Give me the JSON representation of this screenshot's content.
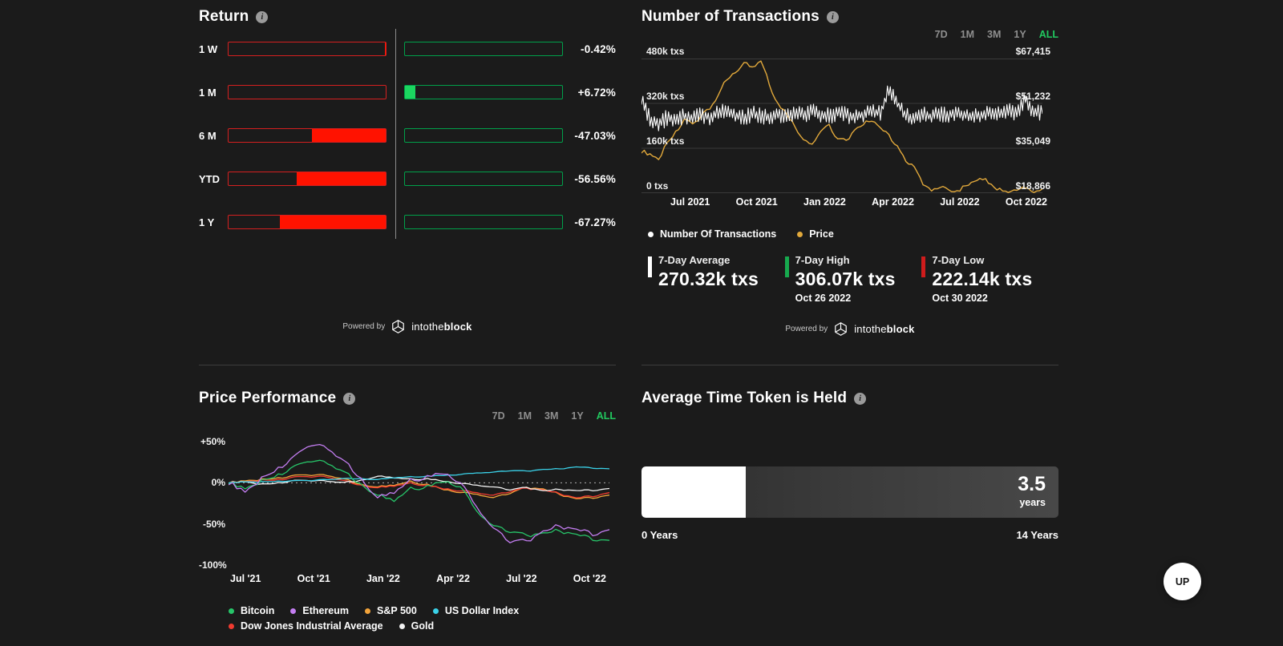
{
  "icons": {
    "info": "i"
  },
  "branding": {
    "powered_by": "Powered by",
    "brand_light": "intothe",
    "brand_bold": "block"
  },
  "up_button": {
    "label": "UP"
  },
  "return_panel": {
    "title": "Return",
    "rows": [
      {
        "label": "1 W",
        "value": "-0.42%",
        "pct": -0.42
      },
      {
        "label": "1 M",
        "value": "+6.72%",
        "pct": 6.72
      },
      {
        "label": "6 M",
        "value": "-47.03%",
        "pct": -47.03
      },
      {
        "label": "YTD",
        "value": "-56.56%",
        "pct": -56.56
      },
      {
        "label": "1 Y",
        "value": "-67.27%",
        "pct": -67.27
      }
    ],
    "colors": {
      "negative": "#ff1200",
      "negative_border": "#d42020",
      "positive": "#1bd760",
      "positive_border": "#00a04a"
    }
  },
  "transactions_panel": {
    "title": "Number of Transactions",
    "ranges": [
      "7D",
      "1M",
      "3M",
      "1Y",
      "ALL"
    ],
    "active_range": "ALL",
    "legend": [
      {
        "label": "Number Of Transactions",
        "color": "#ffffff"
      },
      {
        "label": "Price",
        "color": "#e2a93b"
      }
    ],
    "stats": [
      {
        "label": "7-Day Average",
        "value": "270.32k txs",
        "date": "",
        "color": "#ffffff"
      },
      {
        "label": "7-Day High",
        "value": "306.07k txs",
        "date": "Oct 26 2022",
        "color": "#17a94e"
      },
      {
        "label": "7-Day Low",
        "value": "222.14k txs",
        "date": "Oct 30 2022",
        "color": "#cf1c1c"
      }
    ]
  },
  "performance_panel": {
    "title": "Price Performance",
    "ranges": [
      "7D",
      "1M",
      "3M",
      "1Y",
      "ALL"
    ],
    "active_range": "ALL"
  },
  "avg_held_panel": {
    "title": "Average Time Token is Held",
    "value": "3.5",
    "unit": "years",
    "min_label": "0 Years",
    "max_label": "14 Years",
    "fill_ratio": 0.25
  },
  "chart_data": [
    {
      "type": "line",
      "title": "Number of Transactions",
      "x_labels": [
        "Jul 2021",
        "Oct 2021",
        "Jan 2022",
        "Apr 2022",
        "Jul 2022",
        "Oct 2022"
      ],
      "y_left": {
        "ticks": [
          "480k txs",
          "320k txs",
          "160k txs",
          "0 txs"
        ],
        "min": 0,
        "max": 480,
        "unit": "k txs"
      },
      "y_right": {
        "ticks": [
          "$67,415",
          "$51,232",
          "$35,049",
          "$18,866"
        ],
        "min": 18.866,
        "max": 67.415,
        "unit": "$k"
      },
      "grid": true,
      "legend_position": "bottom",
      "series": [
        {
          "name": "Number Of Transactions",
          "color": "#ffffff",
          "axis": "left",
          "style": "zigzag",
          "wiggle": 30,
          "values": [
            326,
            262,
            250,
            268,
            258,
            274,
            266,
            280,
            270,
            286,
            296,
            278,
            268,
            284,
            276,
            268,
            280,
            272,
            286,
            278,
            290,
            282,
            274,
            286,
            278,
            270,
            282,
            292,
            284,
            372,
            318,
            276,
            268,
            280,
            272,
            284,
            276,
            288,
            280,
            272,
            284,
            292,
            284,
            296,
            288,
            334,
            292,
            284
          ]
        },
        {
          "name": "Price",
          "color": "#e2a93b",
          "axis": "right",
          "style": "noise",
          "wiggle": 0.9,
          "values": [
            34,
            32.5,
            31,
            37,
            41,
            45,
            43.5,
            47,
            49.5,
            54,
            60,
            62.5,
            66,
            64,
            66.5,
            58,
            51,
            47.5,
            43,
            37.5,
            36.5,
            41.5,
            43.5,
            38.5,
            37.5,
            41.5,
            43.5,
            45.5,
            42,
            39.5,
            36,
            30,
            29,
            21.5,
            20,
            21,
            20,
            19.5,
            21.5,
            23,
            24,
            22,
            20,
            19.5,
            19.8,
            20.5,
            19.3,
            20.4
          ]
        }
      ]
    },
    {
      "type": "line",
      "title": "Price Performance",
      "x_labels": [
        "Jul '21",
        "Oct '21",
        "Jan '22",
        "Apr '22",
        "Jul '22",
        "Oct '22"
      ],
      "y_ticks": [
        "+50%",
        "0%",
        "-50%",
        "-100%"
      ],
      "ylim": [
        -100,
        50
      ],
      "zero_line": "dashed",
      "legend_split": 4,
      "draw_order": [
        2,
        4,
        5,
        3,
        0,
        1
      ],
      "series": [
        {
          "name": "Bitcoin",
          "color": "#27c469",
          "wiggle": 3,
          "values": [
            0,
            -8,
            2,
            10,
            18,
            28,
            24,
            12,
            -2,
            -15,
            -22,
            -8,
            -4,
            2,
            -5,
            -35,
            -52,
            -58,
            -65,
            -62,
            -58,
            -64,
            -68,
            -70
          ]
        },
        {
          "name": "Ethereum",
          "color": "#c47ef2",
          "wiggle": 3.5,
          "values": [
            0,
            -12,
            5,
            18,
            30,
            48,
            42,
            25,
            5,
            -18,
            -12,
            2,
            8,
            12,
            0,
            -30,
            -55,
            -70,
            -72,
            -60,
            -52,
            -58,
            -62,
            -57
          ]
        },
        {
          "name": "S&P 500",
          "color": "#f2a33a",
          "wiggle": 1.4,
          "values": [
            0,
            2,
            4,
            6,
            8,
            10,
            9,
            4,
            -2,
            -5,
            -3,
            1,
            -2,
            -8,
            -12,
            -14,
            -18,
            -12,
            -6,
            -8,
            -14,
            -20,
            -18,
            -15
          ]
        },
        {
          "name": "US Dollar Index",
          "color": "#3ad1e8",
          "wiggle": 0.7,
          "values": [
            0,
            1,
            1,
            2,
            2,
            3,
            4,
            5,
            5,
            4,
            6,
            7,
            8,
            9,
            10,
            12,
            13,
            15,
            14,
            16,
            17,
            19,
            18,
            17
          ]
        },
        {
          "name": "Dow Jones Industrial Average",
          "color": "#f03b30",
          "wiggle": 1.4,
          "values": [
            0,
            1,
            3,
            4,
            6,
            8,
            7,
            2,
            -3,
            -6,
            -4,
            -1,
            -3,
            -7,
            -10,
            -12,
            -15,
            -10,
            -7,
            -9,
            -13,
            -19,
            -16,
            -12
          ]
        },
        {
          "name": "Gold",
          "color": "#f2f2f2",
          "wiggle": 1.1,
          "values": [
            0,
            1,
            -2,
            0,
            2,
            3,
            2,
            0,
            3,
            8,
            6,
            4,
            5,
            2,
            -1,
            -3,
            -5,
            -8,
            -6,
            -10,
            -8,
            -10,
            -9,
            -7
          ]
        }
      ]
    }
  ]
}
